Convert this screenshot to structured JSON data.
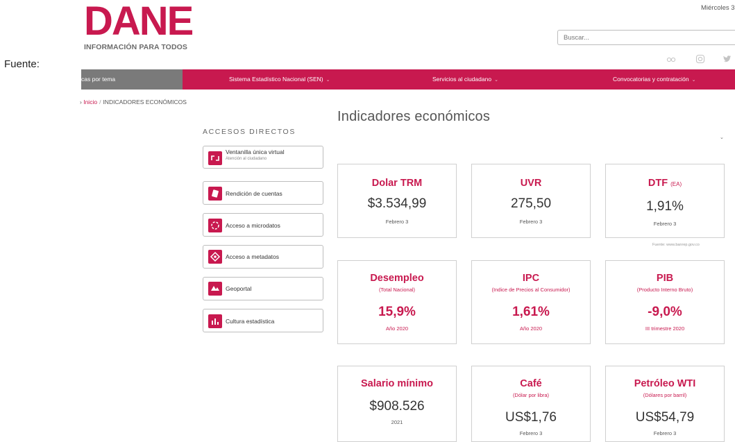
{
  "caption": "Fuente:",
  "logo": {
    "word_main": "DANE",
    "tagline": "INFORMACIÓN PARA TODOS"
  },
  "header": {
    "date": "Miércoles 3",
    "search_placeholder": "Buscar...",
    "social": [
      "flickr-icon",
      "instagram-icon",
      "twitter-icon"
    ]
  },
  "nav": {
    "items": [
      {
        "label": "cas por tema"
      },
      {
        "label": "Sistema Estadístico Nacional (SEN)",
        "chev": "⌄"
      },
      {
        "label": "Servicios al ciudadano",
        "chev": "⌄"
      },
      {
        "label": "Convocatorias y contratación",
        "chev": "⌄"
      }
    ]
  },
  "breadcrumb": {
    "lead": "›",
    "home": "Inicio",
    "sep": "/",
    "current": "INDICADORES ECONÓMICOS"
  },
  "sidebar": {
    "title": "ACCESOS DIRECTOS",
    "items": [
      {
        "label": "Ventanilla única virtual",
        "sub": "Atención al ciudadano",
        "icon": "window-icon"
      },
      {
        "label": "Rendición de cuentas",
        "icon": "accountability-icon"
      },
      {
        "label": "Acceso a microdatos",
        "icon": "microdata-icon"
      },
      {
        "label": "Acceso a metadatos",
        "icon": "metadata-icon"
      },
      {
        "label": "Geoportal",
        "icon": "geoportal-icon"
      },
      {
        "label": "Cultura estadística",
        "icon": "culture-icon"
      }
    ]
  },
  "main": {
    "title": "Indicadores económicos",
    "caret": "⌄",
    "source_note": "Fuente: www.banrep.gov.co",
    "cards": [
      {
        "title": "Dolar TRM",
        "value": "$3.534,99",
        "date": "Febrero 3"
      },
      {
        "title": "UVR",
        "value": "275,50",
        "date": "Febrero 3"
      },
      {
        "title": "DTF",
        "title_small": "(EA)",
        "value": "1,91%",
        "date": "Febrero 3"
      },
      {
        "title": "Desempleo",
        "sub": "(Total Nacional)",
        "value": "15,9%",
        "date": "Año 2020"
      },
      {
        "title": "IPC",
        "sub": "(Indice de Precios al Consumidor)",
        "value": "1,61%",
        "date": "Año 2020"
      },
      {
        "title": "PIB",
        "sub": "(Producto Interno Bruto)",
        "value": "-9,0%",
        "date": "III trimestre 2020"
      },
      {
        "title": "Salario mínimo",
        "value": "$908.526",
        "date": "2021"
      },
      {
        "title": "Café",
        "sub": "(Dólar por libra)",
        "value": "US$1,76",
        "date": "Febrero 3"
      },
      {
        "title": "Petróleo WTI",
        "sub": "(Dólares por barril)",
        "value": "US$54,79",
        "date": "Febrero 3"
      }
    ]
  },
  "colors": {
    "brand": "#c8194f",
    "nav_gray": "#7a7a7a",
    "border": "#cfcfcf"
  }
}
